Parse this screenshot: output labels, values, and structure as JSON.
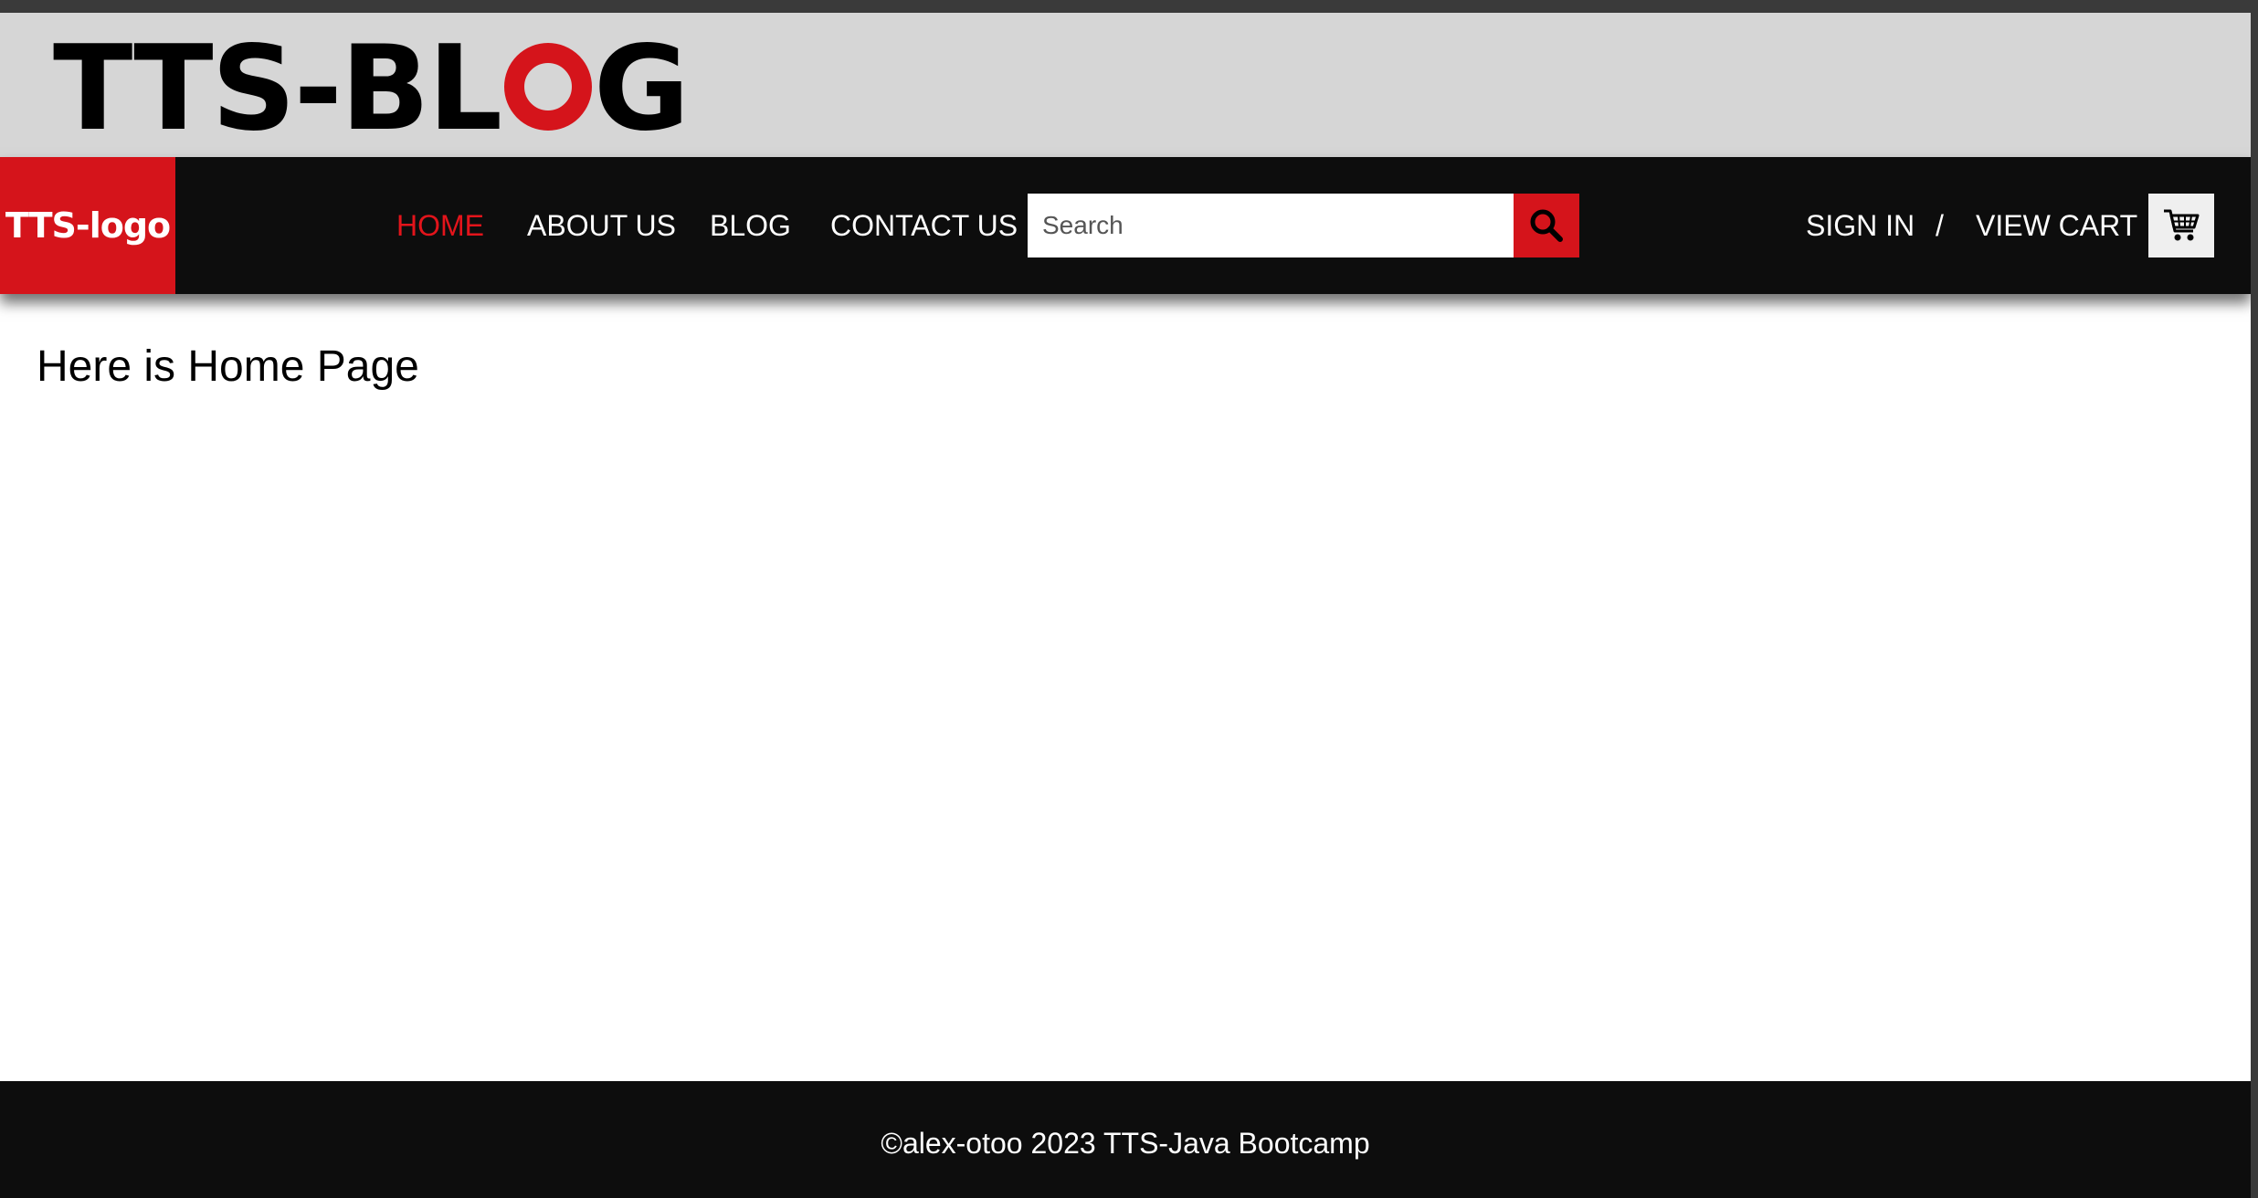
{
  "banner": {
    "brand_prefix": "TTS-BL",
    "brand_o": "O",
    "brand_suffix": "G",
    "brand_full": "TTS-BLOG"
  },
  "navbar": {
    "logo_text": "TTS-logo",
    "links": [
      {
        "label": "HOME",
        "active": true
      },
      {
        "label": "ABOUT US",
        "active": false
      },
      {
        "label": "BLOG",
        "active": false
      },
      {
        "label": "CONTACT US",
        "active": false
      }
    ],
    "search": {
      "placeholder": "Search",
      "value": "",
      "button_icon": "search-icon"
    },
    "sign_in_label": "SIGN IN",
    "separator": "/",
    "view_cart_label": "VIEW CART",
    "cart_icon": "shopping-cart-icon"
  },
  "main": {
    "heading": "Here is Home Page"
  },
  "footer": {
    "text": "©alex-otoo 2023 TTS-Java Bootcamp"
  },
  "colors": {
    "accent_red": "#d5141b",
    "navbar_bg": "#0d0d0d",
    "banner_bg": "#d6d6d6",
    "footer_bg": "#0d0d0d"
  }
}
